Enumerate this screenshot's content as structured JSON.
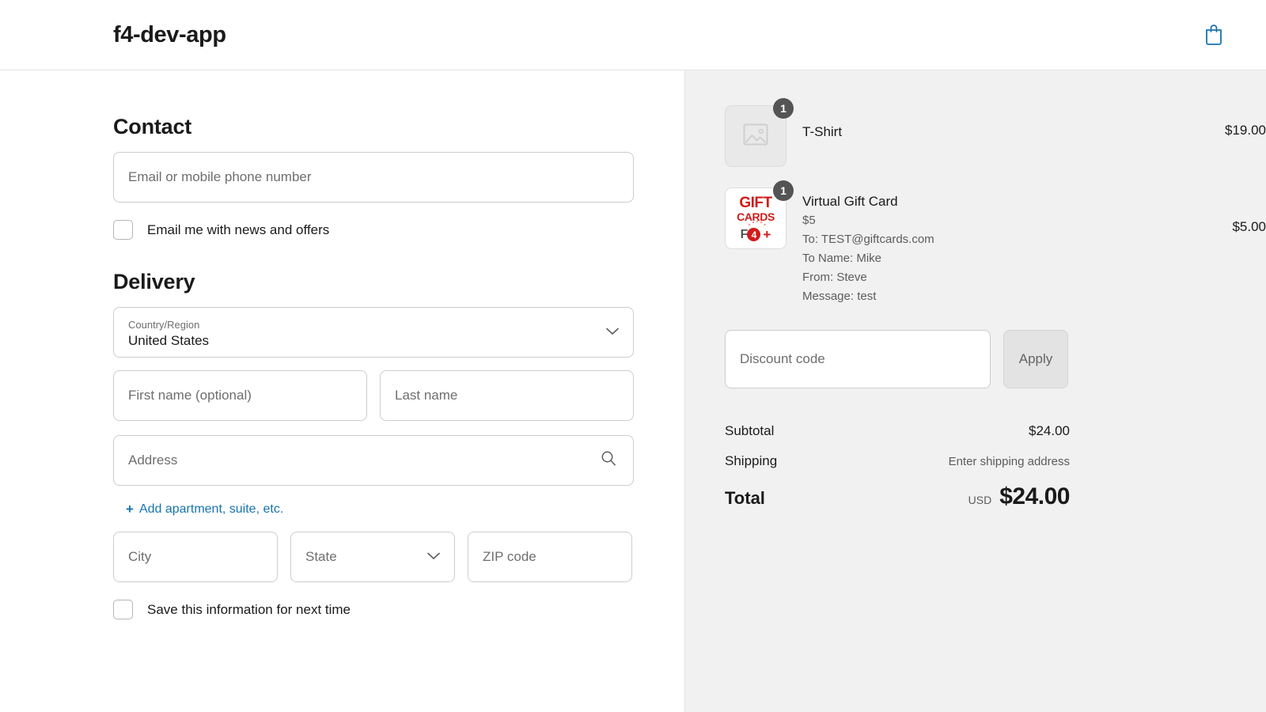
{
  "header": {
    "shop_title": "f4-dev-app",
    "cart_icon": "shopping-bag-icon",
    "cart_icon_color": "#1773b0"
  },
  "contact": {
    "title": "Contact",
    "email_placeholder": "Email or mobile phone number",
    "email_value": "",
    "newsletter_label": "Email me with news and offers",
    "newsletter_checked": false
  },
  "delivery": {
    "title": "Delivery",
    "country": {
      "label": "Country/Region",
      "value": "United States",
      "icon": "chevron-down-icon"
    },
    "first_name_placeholder": "First name (optional)",
    "first_name_value": "",
    "last_name_placeholder": "Last name",
    "last_name_value": "",
    "address_placeholder": "Address",
    "address_value": "",
    "address_icon": "search-icon",
    "add_apartment_link": "Add apartment, suite, etc.",
    "add_apartment_plus": "+",
    "city_placeholder": "City",
    "city_value": "",
    "state_placeholder": "State",
    "state_value": "",
    "state_icon": "chevron-down-icon",
    "zip_placeholder": "ZIP code",
    "zip_value": "",
    "save_info_label": "Save this information for next time",
    "save_info_checked": false
  },
  "summary": {
    "items": [
      {
        "name": "T-Shirt",
        "quantity": "1",
        "price": "$19.00",
        "thumb_type": "image-placeholder-icon",
        "meta": []
      },
      {
        "name": "Virtual Gift Card",
        "quantity": "1",
        "price": "$5.00",
        "thumb_type": "gift-card-art",
        "thumb_text": {
          "line1": "GIFT",
          "line2": "CARDS",
          "badge_letter": "F",
          "badge_number": "4",
          "badge_plus": "+"
        },
        "meta": [
          "$5",
          "To: TEST@giftcards.com",
          "To Name: Mike",
          "From: Steve",
          "Message: test"
        ]
      }
    ],
    "discount": {
      "placeholder": "Discount code",
      "value": "",
      "apply_label": "Apply"
    },
    "subtotal_label": "Subtotal",
    "subtotal_value": "$24.00",
    "shipping_label": "Shipping",
    "shipping_value": "Enter shipping address",
    "total_label": "Total",
    "total_currency": "USD",
    "total_value": "$24.00"
  }
}
